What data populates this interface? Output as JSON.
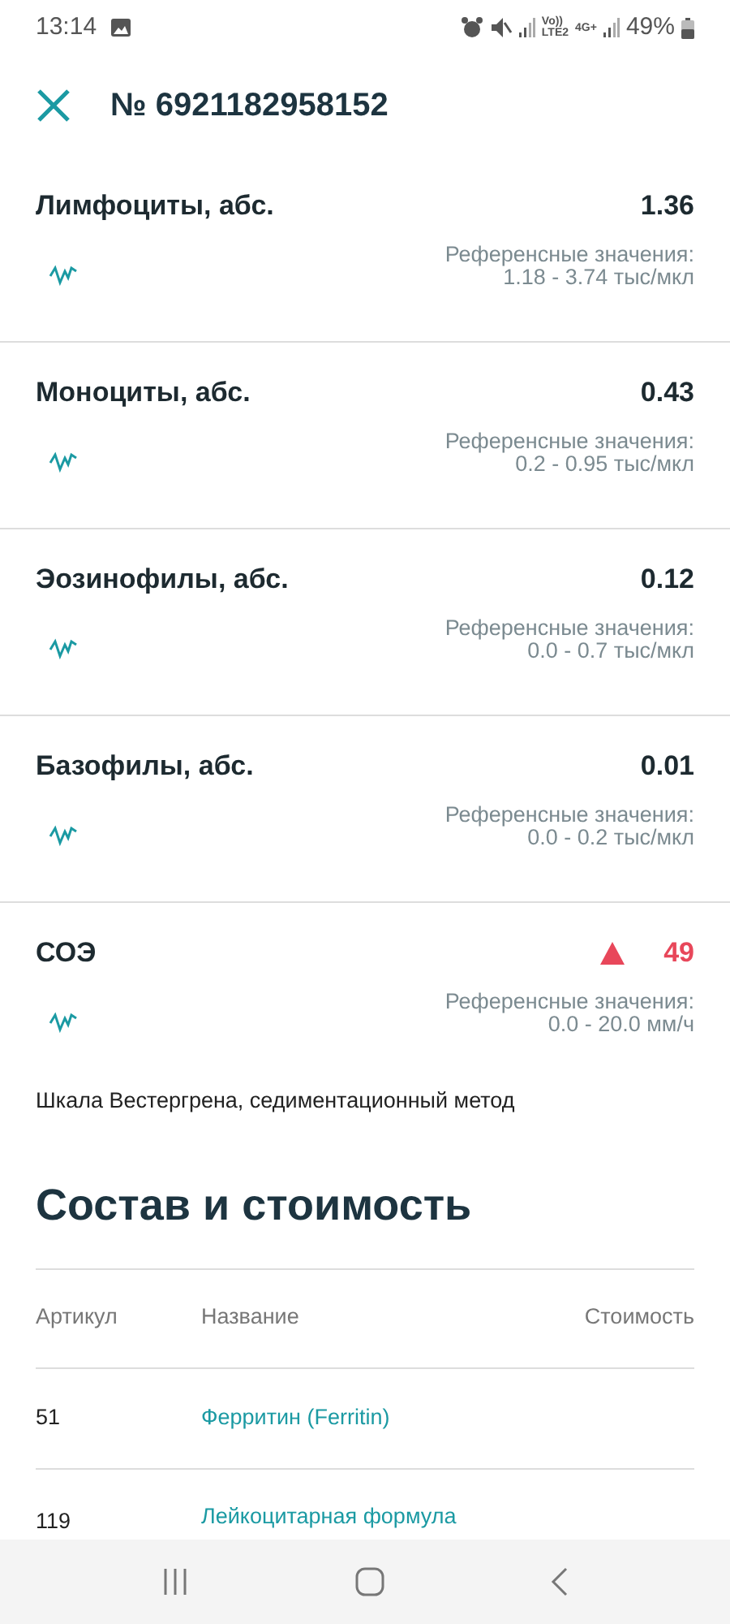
{
  "status_bar": {
    "time": "13:14",
    "network_labels": [
      "Vo))",
      "LTE2",
      "4G+"
    ],
    "battery": "49%"
  },
  "header": {
    "title": "№ 6921182958152"
  },
  "results": [
    {
      "name": "Лимфоциты, абс.",
      "value": "1.36",
      "above_range": false,
      "reference_label": "Референсные значения:",
      "reference_range": "1.18 - 3.74 тыс/мкл"
    },
    {
      "name": "Моноциты, абс.",
      "value": "0.43",
      "above_range": false,
      "reference_label": "Референсные значения:",
      "reference_range": "0.2 - 0.95 тыс/мкл"
    },
    {
      "name": "Эозинофилы, абс.",
      "value": "0.12",
      "above_range": false,
      "reference_label": "Референсные значения:",
      "reference_range": "0.0 - 0.7 тыс/мкл"
    },
    {
      "name": "Базофилы, абс.",
      "value": "0.01",
      "above_range": false,
      "reference_label": "Референсные значения:",
      "reference_range": "0.0 - 0.2 тыс/мкл"
    },
    {
      "name": "СОЭ",
      "value": "49",
      "above_range": true,
      "reference_label": "Референсные значения:",
      "reference_range": "0.0 - 20.0 мм/ч",
      "note": "Шкала Вестергрена, седиментационный метод"
    }
  ],
  "composition": {
    "title": "Состав и стоимость",
    "columns": [
      "Артикул",
      "Название",
      "Стоимость"
    ],
    "rows": [
      {
        "article": "51",
        "name": "Ферритин (Ferritin)"
      },
      {
        "article": "119",
        "name": "Лейкоцитарная формула"
      }
    ]
  }
}
